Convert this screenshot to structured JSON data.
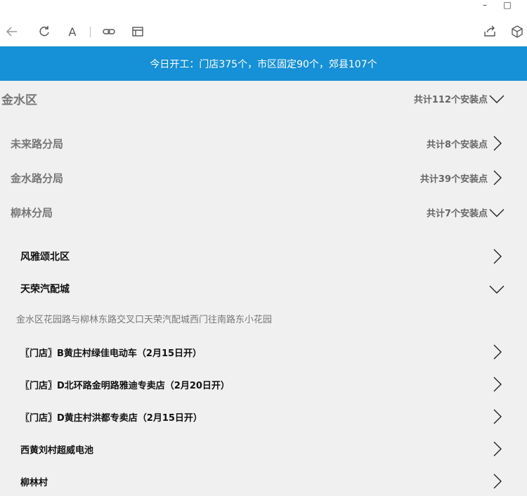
{
  "window": {
    "minimize_glyph": "–",
    "maximize_glyph": "□"
  },
  "toolbar": {
    "icons": [
      "back-icon",
      "refresh-icon",
      "font-icon",
      "link-icon",
      "reader-icon",
      "share-icon",
      "cube-icon"
    ],
    "font_glyph": "A"
  },
  "banner": {
    "text": "今日开工：门店375个，市区固定90个，郊县107个",
    "color": "#1690d6"
  },
  "district": {
    "name": "金水区",
    "count": "共计112个安装点",
    "expanded": true
  },
  "branches": [
    {
      "name": "未来路分局",
      "count": "共计8个安装点",
      "expanded": false
    },
    {
      "name": "金水路分局",
      "count": "共计39个安装点",
      "expanded": false
    },
    {
      "name": "柳林分局",
      "count": "共计7个安装点",
      "expanded": true
    }
  ],
  "areas": [
    {
      "name": "风雅颂北区",
      "expanded": false
    },
    {
      "name": "天荣汽配城",
      "expanded": true
    }
  ],
  "address": "金水区花园路与柳林东路交叉口天荣汽配城西门往南路东小花园",
  "shops": [
    {
      "name": "〖门店〗B黄庄村绿佳电动车（2月15日开）"
    },
    {
      "name": "〖门店〗D北环路金明路雅迪专卖店（2月20日开）"
    },
    {
      "name": "〖门店〗D黄庄村洪都专卖店（2月15日开）"
    },
    {
      "name": "西黄刘村超威电池"
    },
    {
      "name": "柳林村"
    }
  ]
}
